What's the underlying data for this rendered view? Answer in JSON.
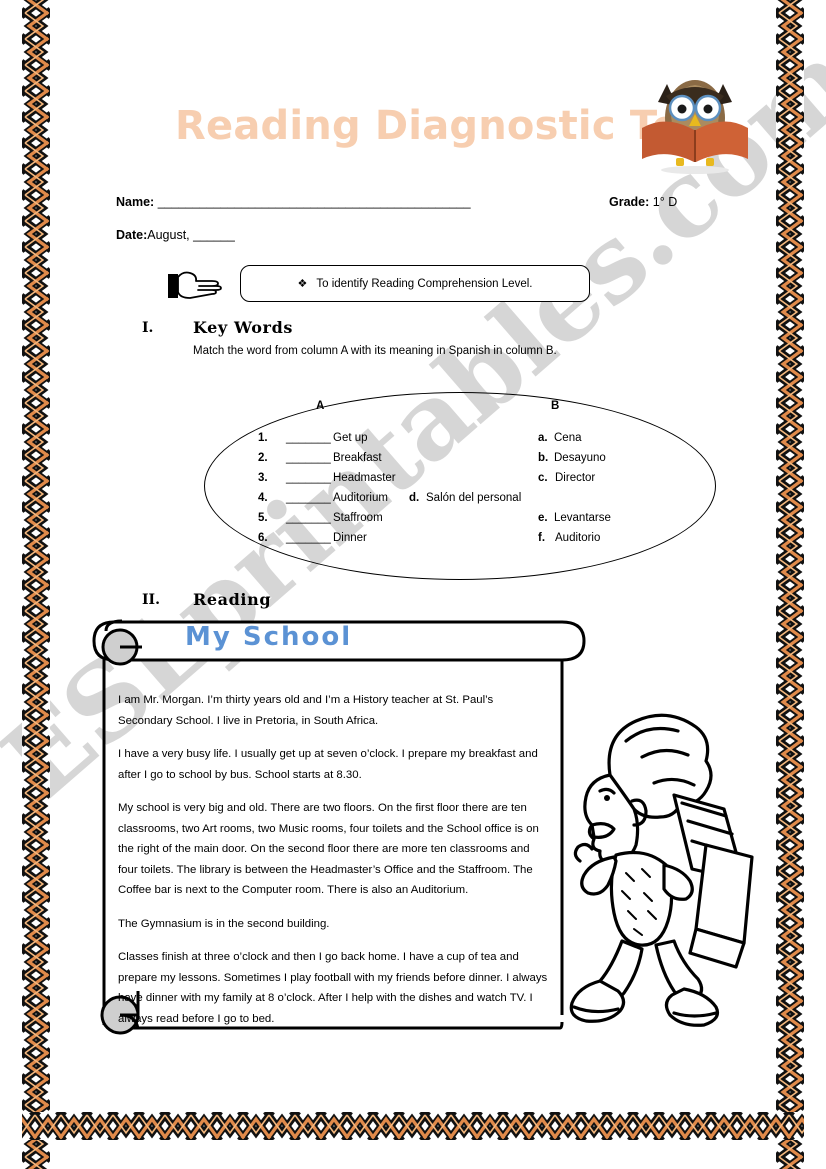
{
  "document": {
    "title": "Reading Diagnostic Test",
    "title_color": "#f7ceb0",
    "watermark": "ESLprintables.com",
    "border_colors": {
      "dark": "#111111",
      "accent": "#e08a4a",
      "light": "#f2b77e"
    }
  },
  "header_fields": {
    "name_label": "Name:",
    "name_rule": "_____________________________________________",
    "date_label": "Date:",
    "date_value": "August, ______",
    "grade_label": "Grade:",
    "grade_value": "1° D"
  },
  "objective": {
    "bullet": "❖",
    "text": "To identify Reading Comprehension Level."
  },
  "sections": [
    {
      "number": "I.",
      "title": "Key Words",
      "instruction": "Match the word from column A with its meaning in Spanish in column B.",
      "column_a_header": "A",
      "column_b_header": "B",
      "blank": "_______",
      "items_a": [
        {
          "num": "1.",
          "word": "Get up"
        },
        {
          "num": "2.",
          "word": "Breakfast"
        },
        {
          "num": "3.",
          "word": "Headmaster"
        },
        {
          "num": "4.",
          "word": "Auditorium"
        },
        {
          "num": "5.",
          "word": "Staffroom"
        },
        {
          "num": "6.",
          "word": "Dinner"
        }
      ],
      "items_b": [
        {
          "letter": "a.",
          "word": "Cena"
        },
        {
          "letter": "b.",
          "word": "Desayuno"
        },
        {
          "letter": "c.",
          "word": "Director"
        },
        {
          "letter": "d.",
          "word": "Salón del personal"
        },
        {
          "letter": "e.",
          "word": "Levantarse"
        },
        {
          "letter": "f.",
          "word": "Auditorio"
        }
      ]
    },
    {
      "number": "II.",
      "title": "Reading"
    }
  ],
  "reading": {
    "heading": "My School",
    "heading_color": "#5b92d4",
    "paragraphs": [
      "I am Mr. Morgan. I’m thirty years old and I’m a History teacher at St. Paul’s  Secondary School. I live in Pretoria, in South Africa.",
      "I have a very busy life. I usually get up at seven o’clock. I prepare my breakfast and after I go to school by bus. School starts at 8.30.",
      "My school is very big and old. There are two floors. On the first floor there are ten classrooms, two Art rooms, two Music rooms, four toilets and the School office is on the right of the main door. On the second floor there are more ten classrooms and four toilets. The library is between the Headmaster’s Office and the Staffroom. The Coffee bar is next to the Computer room. There is also an Auditorium.",
      "The Gymnasium is in the second building.",
      "Classes finish at three o’clock and then I go back home. I have a cup of tea and prepare my lessons. Sometimes I play football with my friends before dinner. I always have dinner with my family at 8 o’clock. After I help with the dishes and watch TV. I always read before I go to bed."
    ]
  },
  "illustrations": {
    "owl": "owl-reading-book-icon",
    "hand": "pointing-hand-icon",
    "boy": "boy-running-with-books-illustration"
  }
}
